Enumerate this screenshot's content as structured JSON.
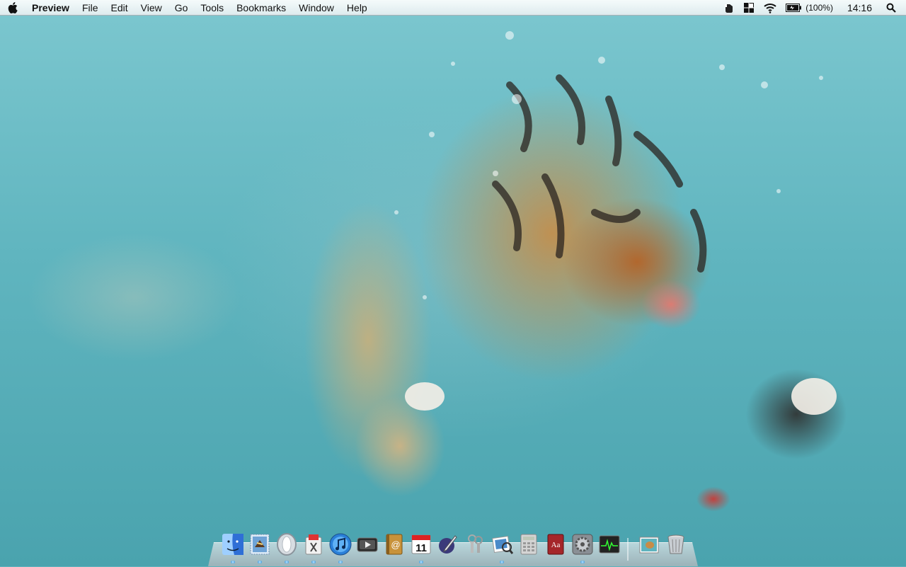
{
  "menubar": {
    "app_name": "Preview",
    "menus": [
      "File",
      "Edit",
      "View",
      "Go",
      "Tools",
      "Bookmarks",
      "Window",
      "Help"
    ],
    "battery_text": "(100%)",
    "clock": "14:16"
  },
  "dock": {
    "items": [
      {
        "name": "finder",
        "icon": "finder-icon",
        "running": true
      },
      {
        "name": "mail",
        "icon": "mail-stamp-icon",
        "running": true
      },
      {
        "name": "opera",
        "icon": "opera-icon",
        "running": true
      },
      {
        "name": "script-editor",
        "icon": "script-editor-icon",
        "running": true
      },
      {
        "name": "itunes",
        "icon": "itunes-icon",
        "running": true
      },
      {
        "name": "dvd-player",
        "icon": "dvd-player-icon",
        "running": false
      },
      {
        "name": "address-book",
        "icon": "address-book-icon",
        "running": false
      },
      {
        "name": "ical",
        "icon": "calendar-icon",
        "label": "11",
        "running": true
      },
      {
        "name": "pen-tool",
        "icon": "pen-app-icon",
        "running": false
      },
      {
        "name": "keychain",
        "icon": "keychain-icon",
        "running": false
      },
      {
        "name": "preview",
        "icon": "preview-icon",
        "running": true
      },
      {
        "name": "calculator",
        "icon": "calculator-icon",
        "running": false
      },
      {
        "name": "dictionary",
        "icon": "dictionary-icon",
        "label": "Aa",
        "running": false
      },
      {
        "name": "system-preferences",
        "icon": "system-preferences-icon",
        "running": true
      },
      {
        "name": "activity-monitor",
        "icon": "activity-monitor-icon",
        "running": false
      },
      {
        "name": "downloads-stack",
        "icon": "stack-icon",
        "running": false
      },
      {
        "name": "trash",
        "icon": "trash-icon",
        "running": false
      }
    ]
  },
  "colors": {
    "water": "#60b5bf",
    "tiger_orange": "#c88c46",
    "indicator": "#2f8fd6"
  }
}
